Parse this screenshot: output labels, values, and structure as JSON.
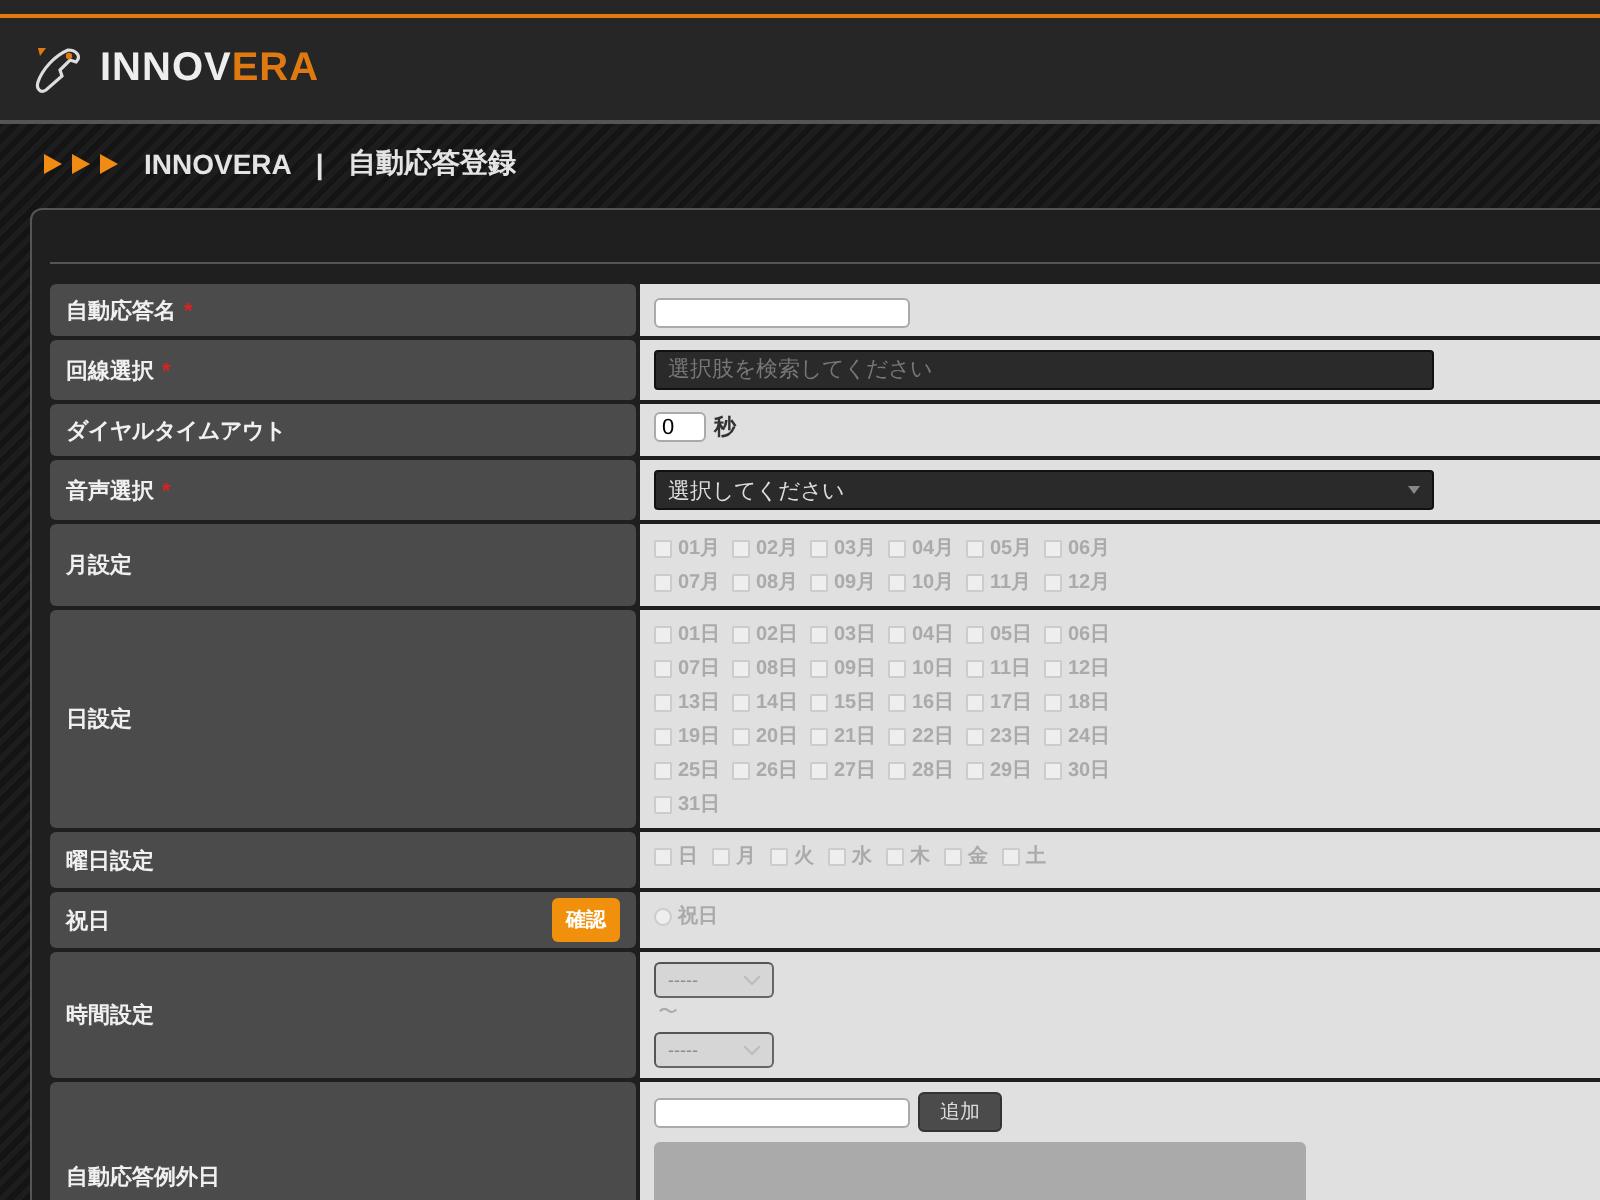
{
  "header": {
    "logo_part1": "INNOV",
    "logo_part2": "ERA"
  },
  "breadcrumb": {
    "items": [
      "INNOVERA",
      "自動応答登録"
    ],
    "separator": "|"
  },
  "form": {
    "rows": [
      {
        "kind": "text",
        "label": "自動応答名",
        "required_mark": "*",
        "value": ""
      },
      {
        "kind": "search",
        "label": "回線選択",
        "required_mark": "*",
        "placeholder": "選択肢を検索してください"
      },
      {
        "kind": "number",
        "label": "ダイヤルタイムアウト",
        "value": "0",
        "unit": "秒"
      },
      {
        "kind": "select",
        "label": "音声選択",
        "required_mark": "*",
        "value": "選択してください"
      },
      {
        "kind": "checks",
        "label": "月設定",
        "disabled": true,
        "options": [
          {
            "label": "01月",
            "checked": false
          },
          {
            "label": "02月",
            "checked": false
          },
          {
            "label": "03月",
            "checked": false
          },
          {
            "label": "04月",
            "checked": false
          },
          {
            "label": "05月",
            "checked": false
          },
          {
            "label": "06月",
            "checked": false
          },
          {
            "label": "07月",
            "checked": false
          },
          {
            "label": "08月",
            "checked": false
          },
          {
            "label": "09月",
            "checked": false
          },
          {
            "label": "10月",
            "checked": false
          },
          {
            "label": "11月",
            "checked": false
          },
          {
            "label": "12月",
            "checked": false
          }
        ]
      },
      {
        "kind": "checks",
        "label": "日設定",
        "disabled": true,
        "options": [
          {
            "label": "01日",
            "checked": false
          },
          {
            "label": "02日",
            "checked": false
          },
          {
            "label": "03日",
            "checked": false
          },
          {
            "label": "04日",
            "checked": false
          },
          {
            "label": "05日",
            "checked": false
          },
          {
            "label": "06日",
            "checked": false
          },
          {
            "label": "07日",
            "checked": false
          },
          {
            "label": "08日",
            "checked": false
          },
          {
            "label": "09日",
            "checked": false
          },
          {
            "label": "10日",
            "checked": false
          },
          {
            "label": "11日",
            "checked": false
          },
          {
            "label": "12日",
            "checked": false
          },
          {
            "label": "13日",
            "checked": false
          },
          {
            "label": "14日",
            "checked": false
          },
          {
            "label": "15日",
            "checked": false
          },
          {
            "label": "16日",
            "checked": false
          },
          {
            "label": "17日",
            "checked": false
          },
          {
            "label": "18日",
            "checked": false
          },
          {
            "label": "19日",
            "checked": false
          },
          {
            "label": "20日",
            "checked": false
          },
          {
            "label": "21日",
            "checked": false
          },
          {
            "label": "22日",
            "checked": false
          },
          {
            "label": "23日",
            "checked": false
          },
          {
            "label": "24日",
            "checked": false
          },
          {
            "label": "25日",
            "checked": false
          },
          {
            "label": "26日",
            "checked": false
          },
          {
            "label": "27日",
            "checked": false
          },
          {
            "label": "28日",
            "checked": false
          },
          {
            "label": "29日",
            "checked": false
          },
          {
            "label": "30日",
            "checked": false
          },
          {
            "label": "31日",
            "checked": false
          }
        ]
      },
      {
        "kind": "weekdays",
        "label": "曜日設定",
        "disabled": true,
        "options": [
          {
            "label": "日",
            "checked": false
          },
          {
            "label": "月",
            "checked": false
          },
          {
            "label": "火",
            "checked": false
          },
          {
            "label": "水",
            "checked": false
          },
          {
            "label": "木",
            "checked": false
          },
          {
            "label": "金",
            "checked": false
          },
          {
            "label": "土",
            "checked": false
          }
        ]
      },
      {
        "kind": "radio",
        "label": "祝日",
        "button": "確認",
        "disabled": true,
        "options": [
          {
            "label": "祝日",
            "selected": false
          }
        ]
      },
      {
        "kind": "time",
        "label": "時間設定",
        "disabled": true,
        "from": "-----",
        "separator": "〜",
        "to": "-----"
      },
      {
        "kind": "exceptions",
        "label": "自動応答例外日",
        "value": "",
        "button": "追加"
      }
    ]
  }
}
